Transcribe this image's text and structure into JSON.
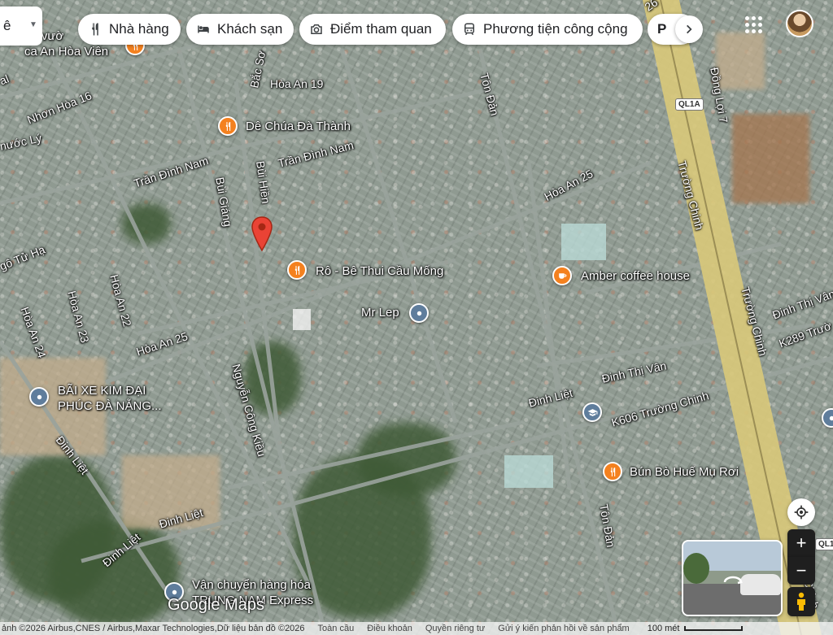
{
  "search": {
    "visible_fragment": "ê"
  },
  "chips": [
    {
      "label": "Nhà hàng",
      "icon": "restaurant-icon"
    },
    {
      "label": "Khách sạn",
      "icon": "hotel-icon"
    },
    {
      "label": "Điểm tham quan",
      "icon": "camera-icon"
    },
    {
      "label": "Phương tiện công cộng",
      "icon": "transit-icon"
    },
    {
      "label": "P",
      "icon": ""
    }
  ],
  "streets": {
    "nhon_hoa_16": "Nhơn Hòa 16",
    "nuoc_ly": "nước Lý",
    "tran_dinh_nam_w": "Trần Đình Nam",
    "tran_dinh_nam_e": "Trần Đình Nam",
    "bac_so": "Bắc Sơ",
    "hoa_an_19": "Hòa An 19",
    "bui_giang": "Bùi Giáng",
    "bui_hien": "Bùi Hiền",
    "ton_dan_n": "Tôn Đản",
    "ton_dan_s": "Tôn Đản",
    "hoa_an_25_e": "Hòa An 25",
    "hoa_an_25_w": "Hòa An 25",
    "truong_chinh_n": "Trường Chinh",
    "truong_chinh_s": "Trường Chinh",
    "dong_loi_7": "Đồng Lợi 7",
    "go_tu_ha": "gô Tử Hạ",
    "hoa_an_22": "Hòa An 22",
    "hoa_an_23": "Hòa An 23",
    "hoa_an_24": "Hòa An 24",
    "nguyen_cong_kieu": "Nguyễn Công Kiều",
    "dinh_thi_van_c": "Đinh Thị Vân",
    "dinh_thi_van_e": "Đinh Thị Vân",
    "k289": "K289 Trườ",
    "dinh_liet_e": "Đinh Liệt",
    "dinh_liet_c": "Đinh Liệt",
    "dinh_liet_sw": "Đinh Liệt",
    "dinh_liet_w": "Đinh Liệt",
    "k606": "K606 Trường Chinh",
    "chinh_edge": "Chinh",
    "al": "al",
    "top_26": "26"
  },
  "shields": {
    "ql1a_n": "QL1A",
    "ql1a_s": "QL1"
  },
  "pois": {
    "hoa_vien_line1": "hê vườ",
    "hoa_vien_line2": "ca An Hòa Viên",
    "de_chua": "Dê Chúa Đà Thành",
    "ro_be": "Rô - Bê Thui Cầu Mống",
    "amber": "Amber coffee house",
    "mr_lep": "Mr Lep",
    "bai_xe_line1": "BÃI XE KIM ĐẠI",
    "bai_xe_line2": "PHÚC ĐÀ NẴNG...",
    "bun_bo": "Bún Bò Huế Mụ Rơi",
    "van_chuyen_line1": "Vận chuyển hàng hóa",
    "van_chuyen_line2": "TRUNG NAM Express"
  },
  "branding": {
    "logo": "Google Maps"
  },
  "footer": {
    "attribution": "ảnh ©2026 Airbus,CNES / Airbus,Maxar Technologies,Dữ liệu bản đồ ©2026",
    "links": [
      "Toàn cầu",
      "Điều khoản",
      "Quyền riêng tư",
      "Gửi ý kiến phản hồi về sản phẩm"
    ],
    "scale": "100 mét"
  },
  "controls": {
    "zoom_in": "+",
    "zoom_out": "−"
  },
  "colors": {
    "food_pin": "#f4811f",
    "place_pin": "#5f7d9c",
    "location_pin": "#ea4335",
    "highway": "#d9c97a"
  }
}
